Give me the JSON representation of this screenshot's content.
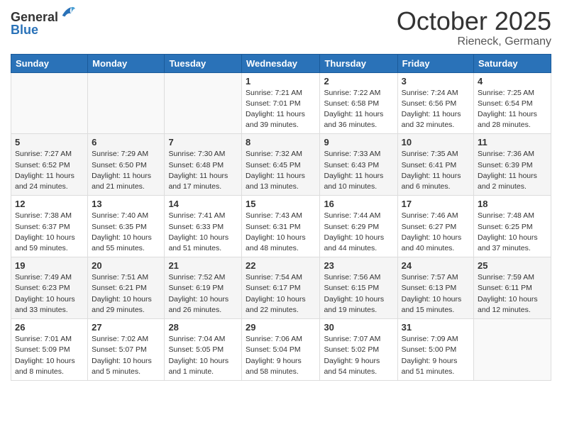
{
  "header": {
    "logo_general": "General",
    "logo_blue": "Blue",
    "title": "October 2025",
    "location": "Rieneck, Germany"
  },
  "days_of_week": [
    "Sunday",
    "Monday",
    "Tuesday",
    "Wednesday",
    "Thursday",
    "Friday",
    "Saturday"
  ],
  "weeks": [
    [
      {
        "day": "",
        "info": ""
      },
      {
        "day": "",
        "info": ""
      },
      {
        "day": "",
        "info": ""
      },
      {
        "day": "1",
        "info": "Sunrise: 7:21 AM\nSunset: 7:01 PM\nDaylight: 11 hours\nand 39 minutes."
      },
      {
        "day": "2",
        "info": "Sunrise: 7:22 AM\nSunset: 6:58 PM\nDaylight: 11 hours\nand 36 minutes."
      },
      {
        "day": "3",
        "info": "Sunrise: 7:24 AM\nSunset: 6:56 PM\nDaylight: 11 hours\nand 32 minutes."
      },
      {
        "day": "4",
        "info": "Sunrise: 7:25 AM\nSunset: 6:54 PM\nDaylight: 11 hours\nand 28 minutes."
      }
    ],
    [
      {
        "day": "5",
        "info": "Sunrise: 7:27 AM\nSunset: 6:52 PM\nDaylight: 11 hours\nand 24 minutes."
      },
      {
        "day": "6",
        "info": "Sunrise: 7:29 AM\nSunset: 6:50 PM\nDaylight: 11 hours\nand 21 minutes."
      },
      {
        "day": "7",
        "info": "Sunrise: 7:30 AM\nSunset: 6:48 PM\nDaylight: 11 hours\nand 17 minutes."
      },
      {
        "day": "8",
        "info": "Sunrise: 7:32 AM\nSunset: 6:45 PM\nDaylight: 11 hours\nand 13 minutes."
      },
      {
        "day": "9",
        "info": "Sunrise: 7:33 AM\nSunset: 6:43 PM\nDaylight: 11 hours\nand 10 minutes."
      },
      {
        "day": "10",
        "info": "Sunrise: 7:35 AM\nSunset: 6:41 PM\nDaylight: 11 hours\nand 6 minutes."
      },
      {
        "day": "11",
        "info": "Sunrise: 7:36 AM\nSunset: 6:39 PM\nDaylight: 11 hours\nand 2 minutes."
      }
    ],
    [
      {
        "day": "12",
        "info": "Sunrise: 7:38 AM\nSunset: 6:37 PM\nDaylight: 10 hours\nand 59 minutes."
      },
      {
        "day": "13",
        "info": "Sunrise: 7:40 AM\nSunset: 6:35 PM\nDaylight: 10 hours\nand 55 minutes."
      },
      {
        "day": "14",
        "info": "Sunrise: 7:41 AM\nSunset: 6:33 PM\nDaylight: 10 hours\nand 51 minutes."
      },
      {
        "day": "15",
        "info": "Sunrise: 7:43 AM\nSunset: 6:31 PM\nDaylight: 10 hours\nand 48 minutes."
      },
      {
        "day": "16",
        "info": "Sunrise: 7:44 AM\nSunset: 6:29 PM\nDaylight: 10 hours\nand 44 minutes."
      },
      {
        "day": "17",
        "info": "Sunrise: 7:46 AM\nSunset: 6:27 PM\nDaylight: 10 hours\nand 40 minutes."
      },
      {
        "day": "18",
        "info": "Sunrise: 7:48 AM\nSunset: 6:25 PM\nDaylight: 10 hours\nand 37 minutes."
      }
    ],
    [
      {
        "day": "19",
        "info": "Sunrise: 7:49 AM\nSunset: 6:23 PM\nDaylight: 10 hours\nand 33 minutes."
      },
      {
        "day": "20",
        "info": "Sunrise: 7:51 AM\nSunset: 6:21 PM\nDaylight: 10 hours\nand 29 minutes."
      },
      {
        "day": "21",
        "info": "Sunrise: 7:52 AM\nSunset: 6:19 PM\nDaylight: 10 hours\nand 26 minutes."
      },
      {
        "day": "22",
        "info": "Sunrise: 7:54 AM\nSunset: 6:17 PM\nDaylight: 10 hours\nand 22 minutes."
      },
      {
        "day": "23",
        "info": "Sunrise: 7:56 AM\nSunset: 6:15 PM\nDaylight: 10 hours\nand 19 minutes."
      },
      {
        "day": "24",
        "info": "Sunrise: 7:57 AM\nSunset: 6:13 PM\nDaylight: 10 hours\nand 15 minutes."
      },
      {
        "day": "25",
        "info": "Sunrise: 7:59 AM\nSunset: 6:11 PM\nDaylight: 10 hours\nand 12 minutes."
      }
    ],
    [
      {
        "day": "26",
        "info": "Sunrise: 7:01 AM\nSunset: 5:09 PM\nDaylight: 10 hours\nand 8 minutes."
      },
      {
        "day": "27",
        "info": "Sunrise: 7:02 AM\nSunset: 5:07 PM\nDaylight: 10 hours\nand 5 minutes."
      },
      {
        "day": "28",
        "info": "Sunrise: 7:04 AM\nSunset: 5:05 PM\nDaylight: 10 hours\nand 1 minute."
      },
      {
        "day": "29",
        "info": "Sunrise: 7:06 AM\nSunset: 5:04 PM\nDaylight: 9 hours\nand 58 minutes."
      },
      {
        "day": "30",
        "info": "Sunrise: 7:07 AM\nSunset: 5:02 PM\nDaylight: 9 hours\nand 54 minutes."
      },
      {
        "day": "31",
        "info": "Sunrise: 7:09 AM\nSunset: 5:00 PM\nDaylight: 9 hours\nand 51 minutes."
      },
      {
        "day": "",
        "info": ""
      }
    ]
  ]
}
